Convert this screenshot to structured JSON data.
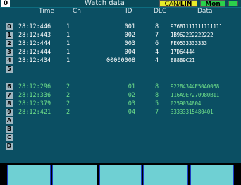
{
  "titlebar": {
    "page": "0",
    "title": "Watch data",
    "mode_can": "CAN",
    "mode_sep": "/",
    "mode_lin": "LIN",
    "mode_mon": "Mon"
  },
  "columns": {
    "time": "Time",
    "ch": "Ch",
    "id": "ID",
    "dlc": "DLC",
    "data": "Data"
  },
  "rows": [
    {
      "idx": "0",
      "time": "28:12:446",
      "ch": "1",
      "id": "001",
      "dlc": "8",
      "data": "976B1111111111111"
    },
    {
      "idx": "1",
      "time": "28:12:443",
      "ch": "1",
      "id": "002",
      "dlc": "7",
      "data": "1B962222222222"
    },
    {
      "idx": "2",
      "time": "28:12:444",
      "ch": "1",
      "id": "003",
      "dlc": "6",
      "data": "FE0533333333"
    },
    {
      "idx": "3",
      "time": "28:12:444",
      "ch": "1",
      "id": "004",
      "dlc": "4",
      "data": "17D64444"
    },
    {
      "idx": "4",
      "time": "28:12:434",
      "ch": "1",
      "id": "00000008",
      "dlc": "4",
      "data": "88889C21"
    },
    {
      "idx": "5",
      "time": "",
      "ch": "",
      "id": "",
      "dlc": "",
      "data": ""
    },
    {
      "idx": "6",
      "time": "28:12:296",
      "ch": "2",
      "id": "01",
      "dlc": "8",
      "data": "922B4344E50A0068"
    },
    {
      "idx": "7",
      "time": "28:12:336",
      "ch": "2",
      "id": "02",
      "dlc": "8",
      "data": "116A9E7270980B11"
    },
    {
      "idx": "8",
      "time": "28:12:379",
      "ch": "2",
      "id": "03",
      "dlc": "5",
      "data": "0259034804"
    },
    {
      "idx": "9",
      "time": "28:12:421",
      "ch": "2",
      "id": "04",
      "dlc": "7",
      "data": "33333315480401"
    },
    {
      "idx": "A",
      "time": "",
      "ch": "",
      "id": "",
      "dlc": "",
      "data": ""
    },
    {
      "idx": "B",
      "time": "",
      "ch": "",
      "id": "",
      "dlc": "",
      "data": ""
    },
    {
      "idx": "C",
      "time": "",
      "ch": "",
      "id": "",
      "dlc": "",
      "data": ""
    },
    {
      "idx": "D",
      "time": "",
      "ch": "",
      "id": "",
      "dlc": "",
      "data": ""
    }
  ],
  "colors": {
    "background": "#0b4f63",
    "ch1_text": "#ffffff",
    "ch2_text": "#6fe08a",
    "index_badge": "#9fb5bf",
    "canlin_badge": "#e7ec2a",
    "mon_badge": "#2bd14b",
    "function_key": "#6fd0d3"
  },
  "function_keys": [
    "",
    "",
    "",
    "",
    "",
    ""
  ]
}
